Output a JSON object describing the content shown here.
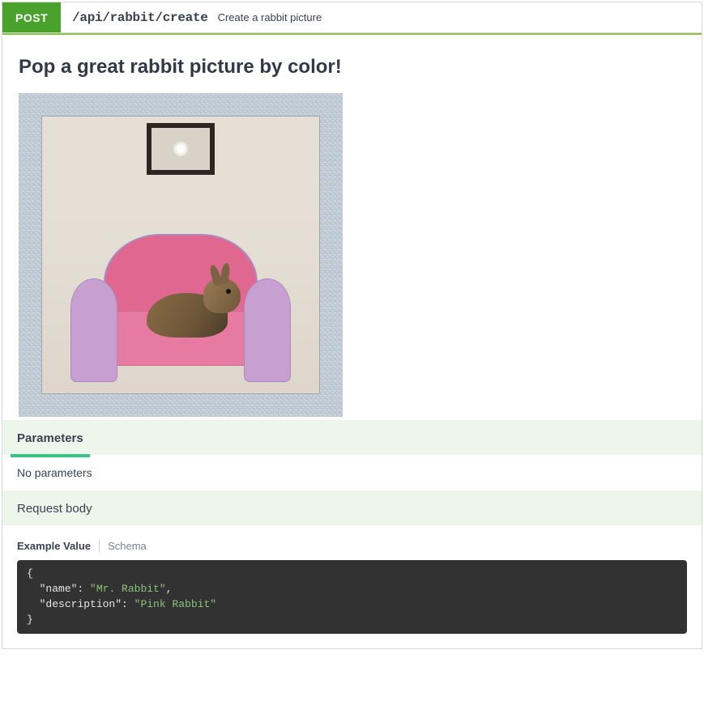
{
  "operation": {
    "method": "POST",
    "path": "/api/rabbit/create",
    "summary": "Create a rabbit picture"
  },
  "description_heading": "Pop a great rabbit picture by color!",
  "sections": {
    "parameters": {
      "title": "Parameters",
      "empty_text": "No parameters"
    },
    "request_body": {
      "title": "Request body"
    }
  },
  "body_tabs": {
    "example": "Example Value",
    "schema": "Schema"
  },
  "example_body": {
    "name": "Mr. Rabbit",
    "description": "Pink Rabbit"
  }
}
